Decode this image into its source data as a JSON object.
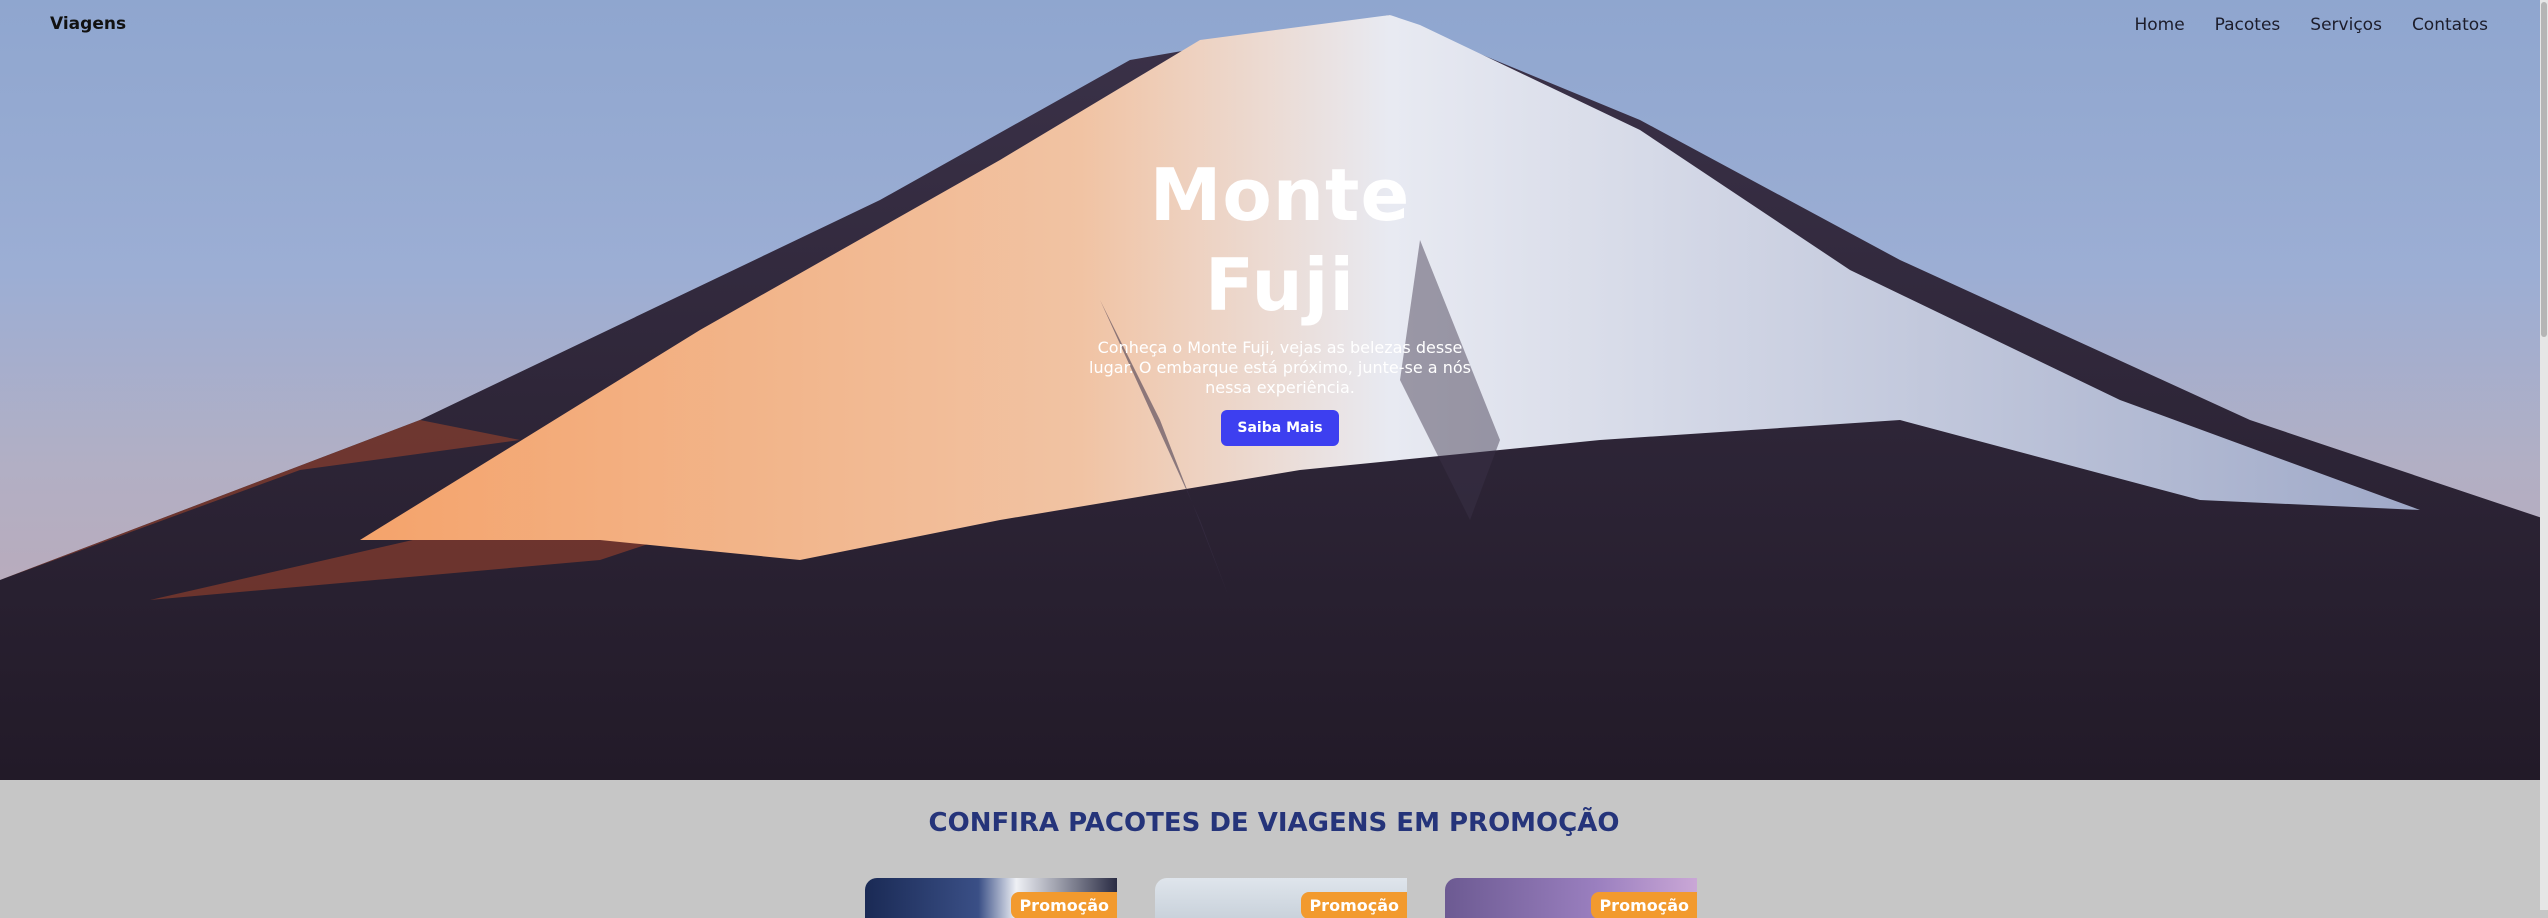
{
  "navbar": {
    "brand": "Viagens",
    "links": [
      "Home",
      "Pacotes",
      "Serviços",
      "Contatos"
    ]
  },
  "hero": {
    "title": "Monte Fuji",
    "description": "Conheça o Monte Fuji, vejas as belezas desse lugar. O embarque está próximo, junte-se a nós nessa experiência.",
    "cta_label": "Saiba Mais"
  },
  "promo": {
    "heading": "CONFIRA PACOTES DE VIAGENS EM PROMOÇÃO",
    "cards": [
      {
        "badge": "Promoção"
      },
      {
        "badge": "Promoção"
      },
      {
        "badge": "Promoção"
      }
    ]
  },
  "colors": {
    "accent": "#3d3ff0",
    "promo_badge": "#f29a2e",
    "heading": "#25347a",
    "section_bg": "#c6c6c6"
  }
}
